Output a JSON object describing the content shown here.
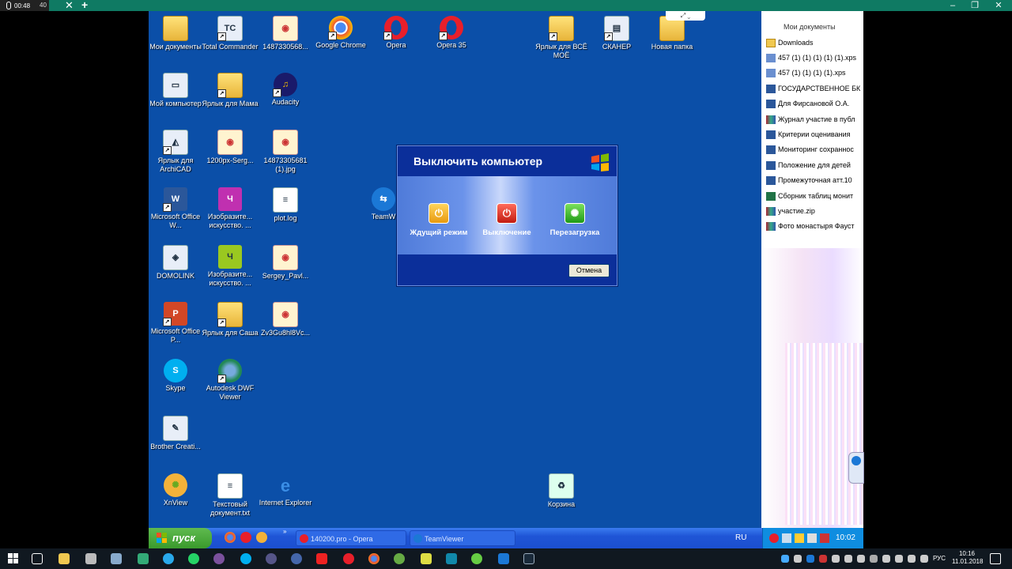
{
  "recorder": {
    "time": "00:48",
    "tab_number": "40"
  },
  "window_controls": {
    "minimize": "–",
    "restore": "❐",
    "close": "✕",
    "tab_close": "✕",
    "tab_add": "+"
  },
  "desktop_icons": [
    {
      "label": "Мои документы",
      "kind": "folder"
    },
    {
      "label": "Total Commander",
      "kind": "app"
    },
    {
      "label": "1487330568...",
      "kind": "jpg"
    },
    {
      "label": "Google Chrome",
      "kind": "app"
    },
    {
      "label": "Opera",
      "kind": "app"
    },
    {
      "label": "Opera 35",
      "kind": "app"
    },
    {
      "label": "Ярлык для ВСЁ МОЁ",
      "kind": "folder"
    },
    {
      "label": "СКАНЕР",
      "kind": "app"
    },
    {
      "label": "Новая папка",
      "kind": "folder"
    },
    {
      "label": "Мой компьютер",
      "kind": "app"
    },
    {
      "label": "Ярлык для Мама",
      "kind": "folder"
    },
    {
      "label": "Audacity",
      "kind": "app"
    },
    {
      "label": "Ярлык для ArchiCAD",
      "kind": "app"
    },
    {
      "label": "1200px-Serg...",
      "kind": "jpg"
    },
    {
      "label": "14873305681 (1).jpg",
      "kind": "jpg"
    },
    {
      "label": "Microsoft Office W...",
      "kind": "app"
    },
    {
      "label": "Изобразите... искусство. ...",
      "kind": "app"
    },
    {
      "label": "plot.log",
      "kind": "app"
    },
    {
      "label": "TeamW",
      "kind": "app"
    },
    {
      "label": "DOMOLINK",
      "kind": "app"
    },
    {
      "label": "Изобразите... искусство. ...",
      "kind": "app"
    },
    {
      "label": "Sergey_Pavl...",
      "kind": "jpg"
    },
    {
      "label": "Microsoft Office P...",
      "kind": "app"
    },
    {
      "label": "Ярлык для Саша",
      "kind": "folder"
    },
    {
      "label": "Zv3Gu8hl8Vc...",
      "kind": "jpg"
    },
    {
      "label": "Skype",
      "kind": "app"
    },
    {
      "label": "Autodesk DWF Viewer",
      "kind": "app"
    },
    {
      "label": "Brother Creati...",
      "kind": "app"
    },
    {
      "label": "XnView",
      "kind": "app"
    },
    {
      "label": "Текстовый документ.txt",
      "kind": "app"
    },
    {
      "label": "Internet Explorer",
      "kind": "app"
    },
    {
      "label": "Корзина",
      "kind": "app"
    }
  ],
  "dialog": {
    "title": "Выключить компьютер",
    "standby": "Ждущий режим",
    "shutdown": "Выключение",
    "restart": "Перезагрузка",
    "cancel": "Отмена"
  },
  "xp_taskbar": {
    "start": "пуск",
    "tasks": [
      "140200.pro - Opera",
      "TeamViewer"
    ],
    "lang": "RU",
    "clock": "10:02"
  },
  "side_panel": {
    "title": "Мои документы",
    "items": [
      "Downloads",
      "457 (1) (1) (1) (1) (1).xps",
      "457 (1) (1) (1) (1).xps",
      "ГОСУДАРСТВЕННОЕ БК",
      "Для Фирсановой О.А.",
      "Журнал участие в публ",
      "Критерии оценивания",
      "Мониторинг сохраннос",
      "Положение для детей",
      "Промежуточная атт.10",
      "Сборник таблиц монит",
      "участие.zip",
      "Фото монастыря Фауст"
    ]
  },
  "w10_taskbar": {
    "lang": "РУС",
    "time": "10:16",
    "date": "11.01.2018"
  }
}
